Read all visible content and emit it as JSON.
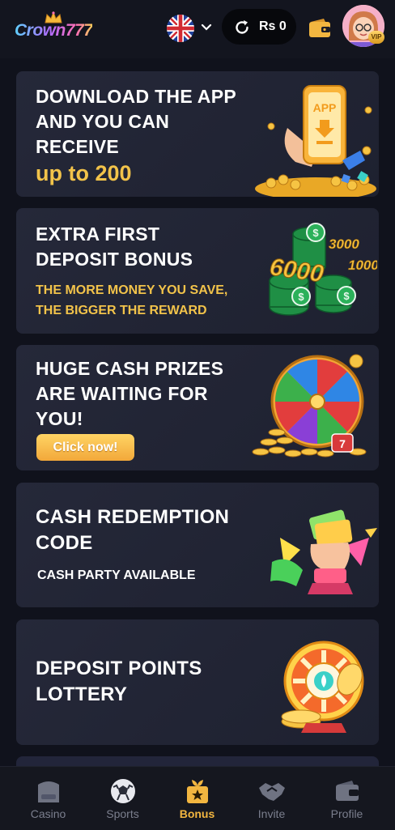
{
  "header": {
    "logo_text": "Crown777",
    "balance": "Rs 0",
    "vip_badge": "VIP"
  },
  "cards": [
    {
      "title_lines": [
        "DOWNLOAD THE APP",
        "AND YOU CAN",
        "RECEIVE"
      ],
      "highlight": "up to 200",
      "art_text": "APP"
    },
    {
      "title_lines": [
        "EXTRA FIRST",
        "DEPOSIT BONUS"
      ],
      "subtitle_lines": [
        "THE MORE MONEY YOU SAVE,",
        "THE BIGGER THE REWARD"
      ],
      "art_numbers": [
        "6000",
        "3000",
        "1000"
      ]
    },
    {
      "title_lines": [
        "HUGE CASH PRIZES",
        "ARE WAITING FOR",
        "YOU!"
      ],
      "button": "Click now!"
    },
    {
      "title_lines": [
        "CASH REDEMPTION",
        "CODE"
      ],
      "subtitle": "CASH PARTY AVAILABLE"
    },
    {
      "title_lines": [
        "DEPOSIT POINTS",
        "LOTTERY"
      ]
    }
  ],
  "bottom_nav": {
    "items": [
      {
        "label": "Casino",
        "icon": "casino-icon"
      },
      {
        "label": "Sports",
        "icon": "soccer-ball-icon"
      },
      {
        "label": "Bonus",
        "icon": "gift-icon"
      },
      {
        "label": "Invite",
        "icon": "handshake-icon"
      },
      {
        "label": "Profile",
        "icon": "wallet-icon"
      }
    ],
    "active_index": 2
  },
  "colors": {
    "background": "#10121c",
    "card": "#23263a",
    "gold": "#f2c34a",
    "active_nav": "#f2b640",
    "inactive_nav": "#7b7f8e"
  }
}
